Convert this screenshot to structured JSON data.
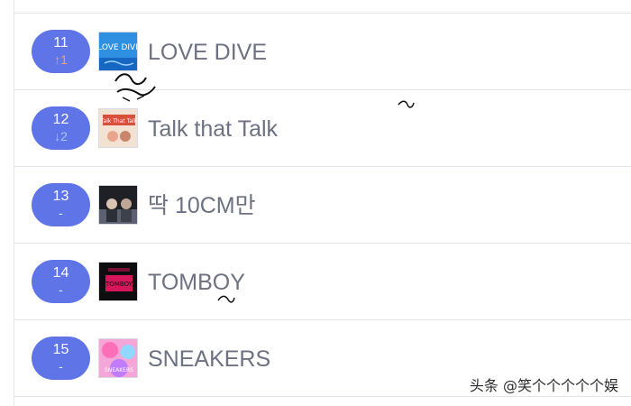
{
  "songs": [
    {
      "rank": "11",
      "change_symbol": "↑1",
      "change_type": "up",
      "title": "LOVE DIVE",
      "cover_icon": "love-dive-cover-icon"
    },
    {
      "rank": "12",
      "change_symbol": "↓2",
      "change_type": "down",
      "title": "Talk that Talk",
      "cover_icon": "talk-that-talk-cover-icon"
    },
    {
      "rank": "13",
      "change_symbol": "-",
      "change_type": "same",
      "title": "딱 10CM만",
      "cover_icon": "ddak-10cm-cover-icon"
    },
    {
      "rank": "14",
      "change_symbol": "-",
      "change_type": "same",
      "title": "TOMBOY",
      "cover_icon": "tomboy-cover-icon"
    },
    {
      "rank": "15",
      "change_symbol": "-",
      "change_type": "same",
      "title": "SNEAKERS",
      "cover_icon": "sneakers-cover-icon"
    }
  ],
  "colors": {
    "pill_bg": "#5f74e6",
    "up": "#f0a46a",
    "down": "#a9c6ff",
    "title_text": "#6d7282"
  },
  "cover_art_text": {
    "love_dive": "LOVE DIVE",
    "talk_that_talk": "Talk That Talk",
    "tomboy": "TOMBOY",
    "sneakers": "SNEAKERS"
  },
  "watermark": "头条 @笑个个个个个娱"
}
